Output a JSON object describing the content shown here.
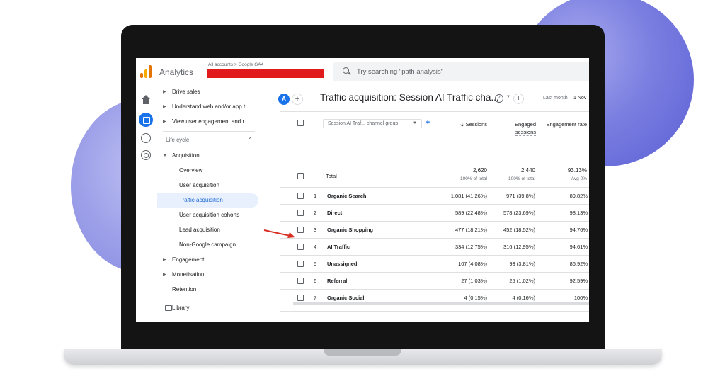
{
  "app": {
    "name": "Analytics",
    "breadcrumb": "All accounts > Google GA4"
  },
  "search": {
    "placeholder": "Try searching \"path analysis\""
  },
  "nav": {
    "top_items": [
      "Drive sales",
      "Understand web and/or app t...",
      "View user engagement and r..."
    ],
    "section_label": "Life cycle",
    "acquisition": "Acquisition",
    "acquisition_children": [
      "Overview",
      "User acquisition",
      "Traffic acquisition",
      "User acquisition cohorts",
      "Lead acquisition",
      "Non-Google campaign"
    ],
    "active_item": "Traffic acquisition",
    "engagement": "Engagement",
    "monetisation": "Monetisation",
    "retention": "Retention",
    "library": "Library"
  },
  "report": {
    "avatar": "A",
    "title": "Traffic acquisition: Session AI Traffic cha...",
    "date_label": "Last month",
    "date_value": "1 Nov"
  },
  "table": {
    "dimension_selector": "Session AI Traf... channel group",
    "columns": [
      {
        "label": "Sessions",
        "sorted": true
      },
      {
        "label": "Engaged sessions"
      },
      {
        "label": "Engagement rate"
      }
    ],
    "total": {
      "label": "Total",
      "sessions": "2,620",
      "sessions_pct": "100% of total",
      "engaged": "2,440",
      "engaged_pct": "100% of total",
      "rate": "93.13%",
      "rate_avg": "Avg 0%"
    },
    "rows": [
      {
        "index": "1",
        "name": "Organic Search",
        "sessions": "1,081 (41.26%)",
        "engaged": "971 (39.8%)",
        "rate": "89.82%"
      },
      {
        "index": "2",
        "name": "Direct",
        "sessions": "589 (22.48%)",
        "engaged": "578 (23.69%)",
        "rate": "98.13%"
      },
      {
        "index": "3",
        "name": "Organic Shopping",
        "sessions": "477 (18.21%)",
        "engaged": "452 (18.52%)",
        "rate": "94.76%"
      },
      {
        "index": "4",
        "name": "AI Traffic",
        "sessions": "334 (12.75%)",
        "engaged": "316 (12.95%)",
        "rate": "94.61%"
      },
      {
        "index": "5",
        "name": "Unassigned",
        "sessions": "107 (4.08%)",
        "engaged": "93 (3.81%)",
        "rate": "86.92%"
      },
      {
        "index": "6",
        "name": "Referral",
        "sessions": "27 (1.03%)",
        "engaged": "25 (1.02%)",
        "rate": "92.59%"
      },
      {
        "index": "7",
        "name": "Organic Social",
        "sessions": "4 (0.15%)",
        "engaged": "4 (0.16%)",
        "rate": "100%"
      }
    ]
  },
  "colors": {
    "accent": "#1a73e8",
    "highlight": "#e8f0fe",
    "redaction": "#e11b1b",
    "arrow": "#d93025",
    "blob": "#6b6fdc"
  },
  "icons": [
    "analytics-logo-icon",
    "search-icon",
    "home-icon",
    "reports-icon",
    "explore-icon",
    "advertising-icon",
    "folder-icon",
    "check-circle-icon",
    "sort-down-icon",
    "red-arrow-icon"
  ]
}
